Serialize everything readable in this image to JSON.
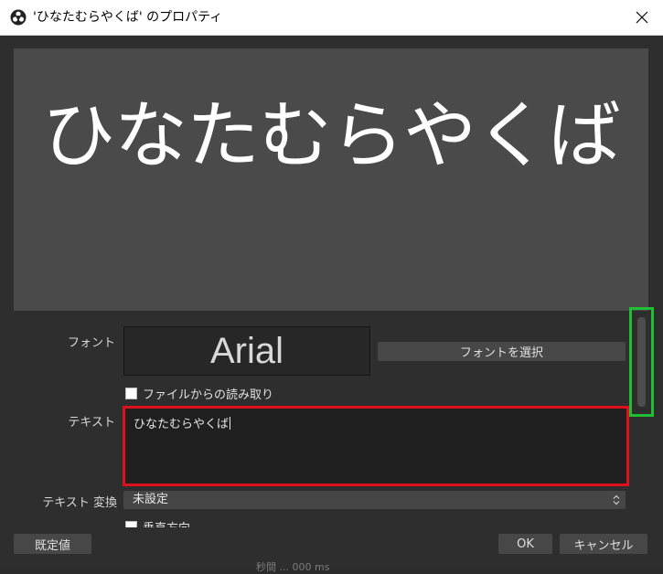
{
  "window": {
    "title": "'ひなたむらやくば' のプロパティ",
    "app_icon": "obs-icon",
    "close_icon": "close-icon"
  },
  "preview": {
    "text": "ひなたむらやくば"
  },
  "font": {
    "label": "フォント",
    "current_font": "Arial",
    "select_button": "フォントを選択"
  },
  "read_from_file": {
    "label": "ファイルからの読み取り",
    "checked": false
  },
  "text_field": {
    "label": "テキスト",
    "value": "ひなたむらやくば"
  },
  "text_transform": {
    "label": "テキスト 変換",
    "value": "未設定"
  },
  "vertical": {
    "label": "垂直方向",
    "checked": false
  },
  "buttons": {
    "defaults": "既定値",
    "ok": "OK",
    "cancel": "キャンセル"
  },
  "background_window": {
    "partial_text": "秒間 ... 000 ms"
  },
  "colors": {
    "highlight_red": "#e0101b",
    "highlight_green": "#1fbf33",
    "dialog_bg": "#2e2e2e",
    "preview_bg": "#4a4a4a"
  }
}
